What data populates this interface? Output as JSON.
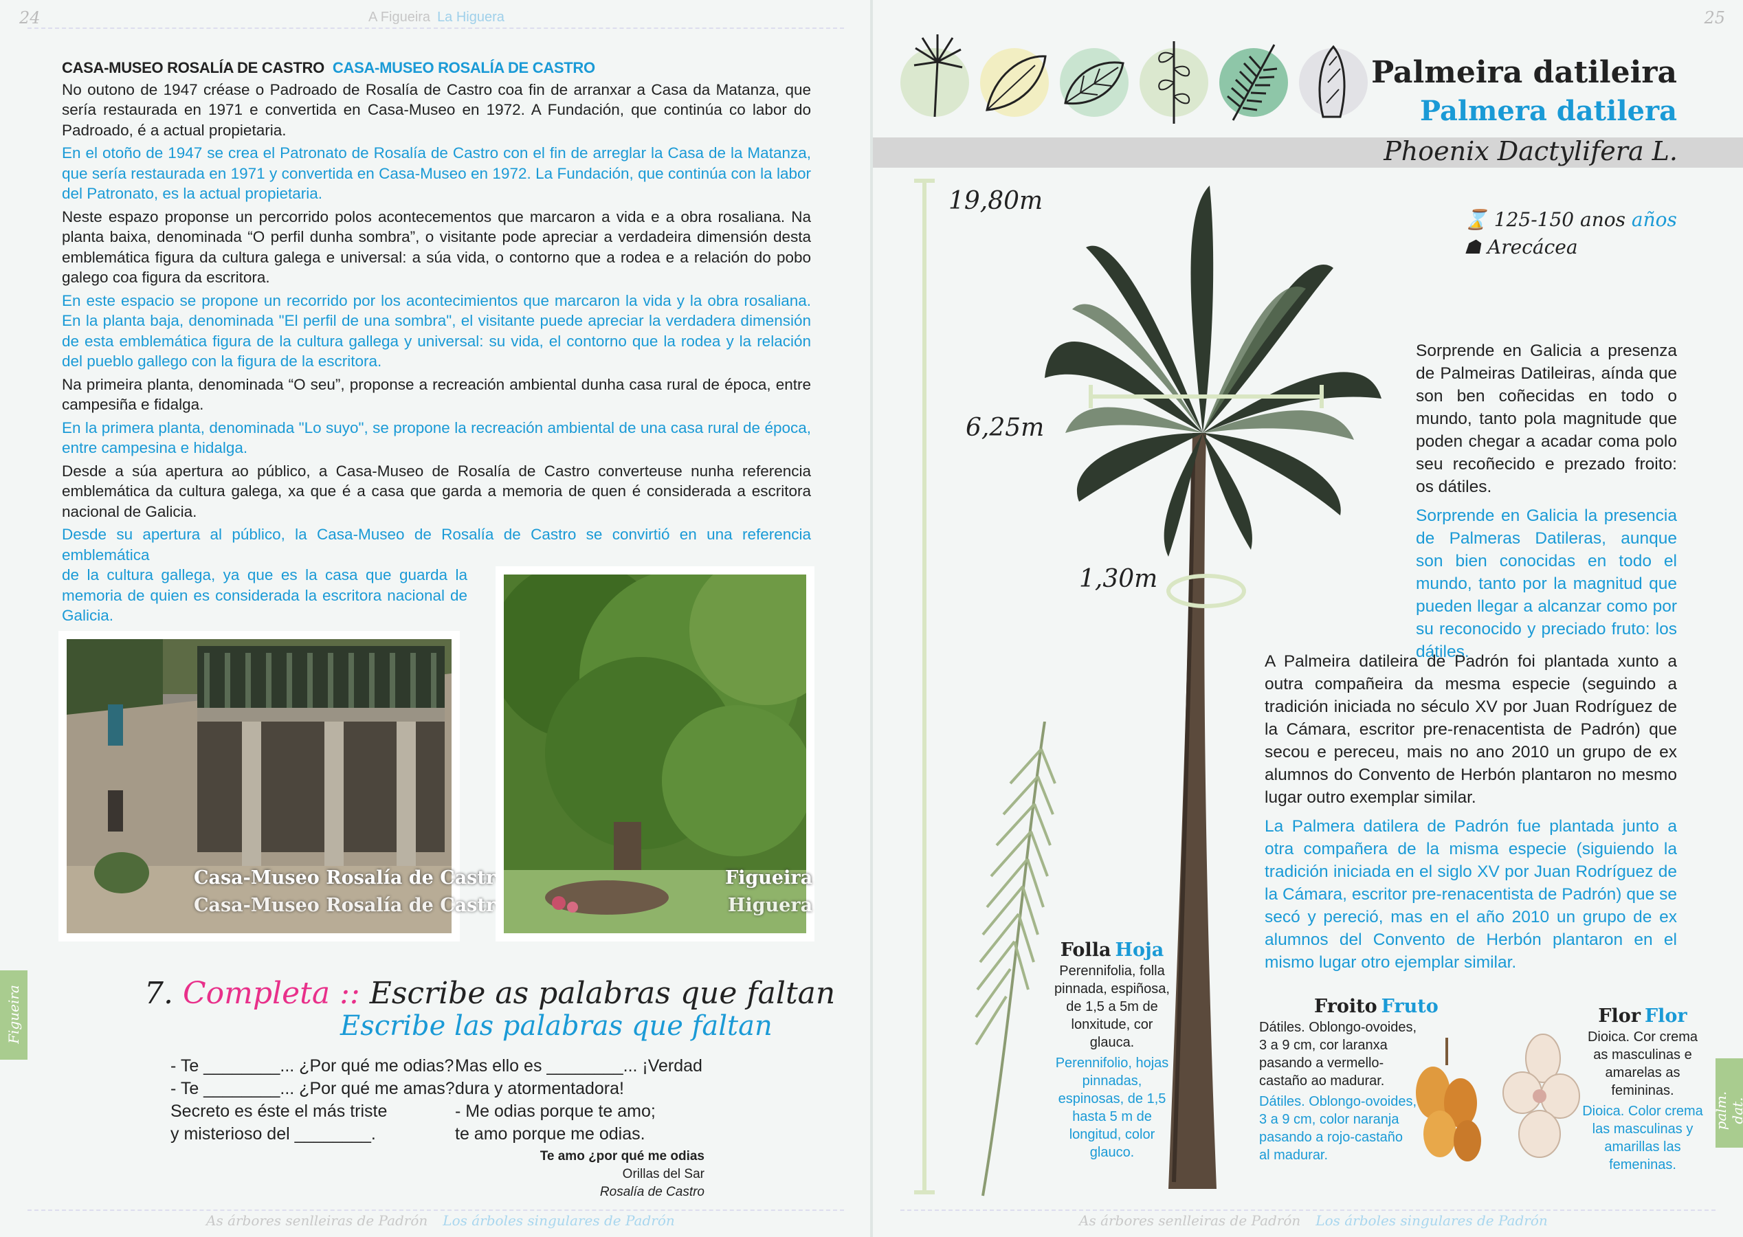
{
  "left_page": {
    "page_number": "24",
    "running_head_gl": "A Figueira",
    "running_head_es": "La Higuera",
    "heading_gl": "CASA-MUSEO ROSALÍA DE CASTRO",
    "heading_es": "CASA-MUSEO ROSALÍA DE CASTRO",
    "p1_gl": "No outono de 1947 créase o Padroado de Rosalía de Castro coa fin de arranxar a Casa da Matanza, que sería restaurada en 1971 e convertida en Casa-Museo en 1972. A Fundación, que continúa co labor do Padroado, é a actual propietaria.",
    "p1_es": "En el otoño de 1947 se crea el Patronato de Rosalía de Castro con el fin de arreglar la Casa de la Matanza, que sería restaurada en 1971 y convertida en Casa-Museo en 1972. La Fundación, que continúa con la labor del Patronato, es la actual propietaria.",
    "p2_gl": "Neste espazo proponse un percorrido polos acontecementos que marcaron a vida e a obra rosaliana. Na planta baixa, denominada “O perfil dunha sombra”, o visitante pode apreciar a verdadeira dimensión desta emblemática figura da cultura galega e universal: a súa vida, o contorno que a rodea e a relación do pobo galego coa figura da escritora.",
    "p2_es": "En este espacio se propone un recorrido por los acontecimientos que marcaron la vida y la obra rosaliana. En la planta baja, denominada \"El perfil de una sombra\", el visitante puede apreciar la verdadera dimensión de esta emblemática figura de la cultura gallega y universal: su vida, el contorno que la rodea y la relación del pueblo gallego con la figura de la escritora.",
    "p3_gl": "Na primeira planta, denominada “O seu”, proponse a recreación ambiental dunha casa rural de época, entre campesiña e fidalga.",
    "p3_es": "En la primera planta, denominada \"Lo suyo\", se propone la recreación ambiental de una casa rural de época, entre campesina e hidalga.",
    "p4_gl": "Desde a súa apertura ao público, a Casa-Museo de Rosalía de Castro converteuse nunha referencia emblemática da cultura galega, xa que é a casa que garda a memoria de quen é considerada a escritora nacional de Galicia.",
    "p4_es_a": "Desde su apertura al público, la Casa-Museo de Rosalía de Castro se convirtió en una referencia emblemática",
    "p4_es_b": "de la cultura gallega, ya que es la casa que guarda la memoria de quien es considerada la escritora nacional de Galicia.",
    "photo1_caption_gl": "Casa-Museo Rosalía de Castro",
    "photo1_caption_es": "Casa-Museo Rosalía de Castro",
    "photo2_caption_gl": "Figueira",
    "photo2_caption_es": "Higuera",
    "exercise_number": "7.",
    "exercise_word": "Completa",
    "exercise_sep": "::",
    "exercise_gl": "Escribe as palabras que faltan",
    "exercise_es": "Escribe las palabras que faltan",
    "poem_col1": [
      "- Te ________... ¿Por qué me odias?",
      "- Te ________... ¿Por qué me amas?",
      "Secreto es éste el más triste",
      "y misterioso del ________."
    ],
    "poem_col2": [
      "Mas ello es ________... ¡Verdad",
      "dura y atormentadora!",
      "- Me odias porque te amo;",
      "te amo porque me odias."
    ],
    "poem_title": "Te amo ¿por qué me odias",
    "poem_source": "Orillas del Sar",
    "poem_author": "Rosalía de Castro",
    "side_tab": "Figueira",
    "footer_gl": "As árbores senlleiras de Padrón",
    "footer_es": "Los árboles singulares de Padrón"
  },
  "right_page": {
    "page_number": "25",
    "title_gl": "Palmeira datileira",
    "title_es": "Palmera datilera",
    "scientific_name": "Phoenix Dactylifera L.",
    "height": "19,80m",
    "crown_width": "6,25m",
    "trunk_girth": "1,30m",
    "age_gl": "125-150 anos",
    "age_es": "años",
    "family": "Arecácea",
    "icon_names": [
      "palm-icon",
      "leaf-icon",
      "broadleaf-icon",
      "branch-icon",
      "fern-leaf-icon",
      "needle-leaf-icon"
    ],
    "intro_gl": "Sorprende en Galicia a presenza de Palmeiras Datileiras, aínda que son ben coñecidas en todo o mundo, tanto pola magnitude que poden chegar a acadar coma polo seu recoñecido e prezado froito: os dátiles.",
    "intro_es": "Sorprende en Galicia la presencia de Palmeras Datileras, aunque son bien conocidas en todo el mundo, tanto por la magnitud que pueden llegar a alcanzar como por su reconocido y preciado fruto: los dátiles.",
    "history_gl": "A Palmeira datileira de Padrón foi plantada xunto a outra compañeira da mesma especie (seguindo a tradición iniciada no século XV por Juan Rodríguez de la Cámara, escritor pre-renacentista de Padrón) que secou e pereceu, mais no ano 2010 un grupo de ex alumnos do Convento de Herbón plantaron no mesmo lugar outro exemplar similar.",
    "history_es": "La Palmera datilera de Padrón fue plantada junto a otra compañera de la misma especie (siguiendo la tradición iniciada en el siglo XV por Juan Rodríguez de la Cámara, escritor pre-renacentista de Padrón) que se secó y pereció, mas en el año 2010 un grupo de ex alumnos del Convento de Herbón plantaron en el mismo lugar otro ejemplar similar.",
    "leaf_h_gl": "Folla",
    "leaf_h_es": "Hoja",
    "leaf_gl": "Perennifolia, folla pinnada, espiñosa, de 1,5 a 5m de lonxitude, cor glauca.",
    "leaf_es": "Perennifolio, hojas pinnadas, espinosas, de 1,5 hasta 5 m de longitud, color glauco.",
    "fruit_h_gl": "Froito",
    "fruit_h_es": "Fruto",
    "fruit_gl": "Dátiles. Oblongo-ovoides, 3 a 9 cm, cor laranxa pasando a vermello-castaño ao madurar.",
    "fruit_es": "Dátiles. Oblongo-ovoides, 3 a 9 cm, color naranja pasando a rojo-castaño al madurar.",
    "flower_h_gl": "Flor",
    "flower_h_es": "Flor",
    "flower_gl": "Dioica. Cor crema as masculinas e amarelas as femininas.",
    "flower_es": "Dioica. Color crema las masculinas y amarillas las femeninas.",
    "side_tab": "palm. dat.",
    "footer_gl": "As árbores senlleiras de Padrón",
    "footer_es": "Los árboles singulares de Padrón"
  },
  "colors": {
    "spanish_text": "#1a9ad6",
    "exercise_pink": "#e8308a",
    "tab_green": "#a9cc8f",
    "background": "#f3f6f5"
  }
}
